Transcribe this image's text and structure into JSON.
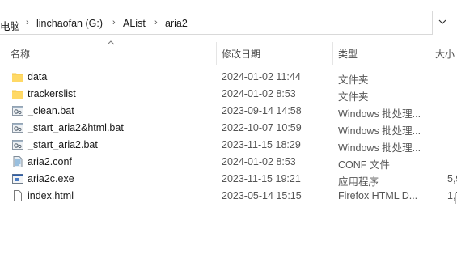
{
  "address": {
    "crumbs": [
      "电脑",
      "linchaofan (G:)",
      "AList",
      "aria2"
    ]
  },
  "columns": {
    "name": "名称",
    "date": "修改日期",
    "type": "类型",
    "size": "大小"
  },
  "files": [
    {
      "icon": "folder-icon",
      "name": "data",
      "date": "2024-01-02 11:44",
      "type": "文件夹",
      "size": ""
    },
    {
      "icon": "folder-icon",
      "name": "trackerslist",
      "date": "2024-01-02 8:53",
      "type": "文件夹",
      "size": ""
    },
    {
      "icon": "batch-file-icon",
      "name": "_clean.bat",
      "date": "2023-09-14 14:58",
      "type": "Windows 批处理...",
      "size": ""
    },
    {
      "icon": "batch-file-icon",
      "name": "_start_aria2&html.bat",
      "date": "2022-10-07 10:59",
      "type": "Windows 批处理...",
      "size": ""
    },
    {
      "icon": "batch-file-icon",
      "name": "_start_aria2.bat",
      "date": "2023-11-15 18:29",
      "type": "Windows 批处理...",
      "size": ""
    },
    {
      "icon": "config-file-icon",
      "name": "aria2.conf",
      "date": "2024-01-02 8:53",
      "type": "CONF 文件",
      "size": ""
    },
    {
      "icon": "executable-icon",
      "name": "aria2c.exe",
      "date": "2023-11-15 19:21",
      "type": "应用程序",
      "size": "5,9"
    },
    {
      "icon": "document-icon",
      "name": "index.html",
      "date": "2023-05-14 15:15",
      "type": "Firefox HTML D...",
      "size": "1,7"
    }
  ]
}
